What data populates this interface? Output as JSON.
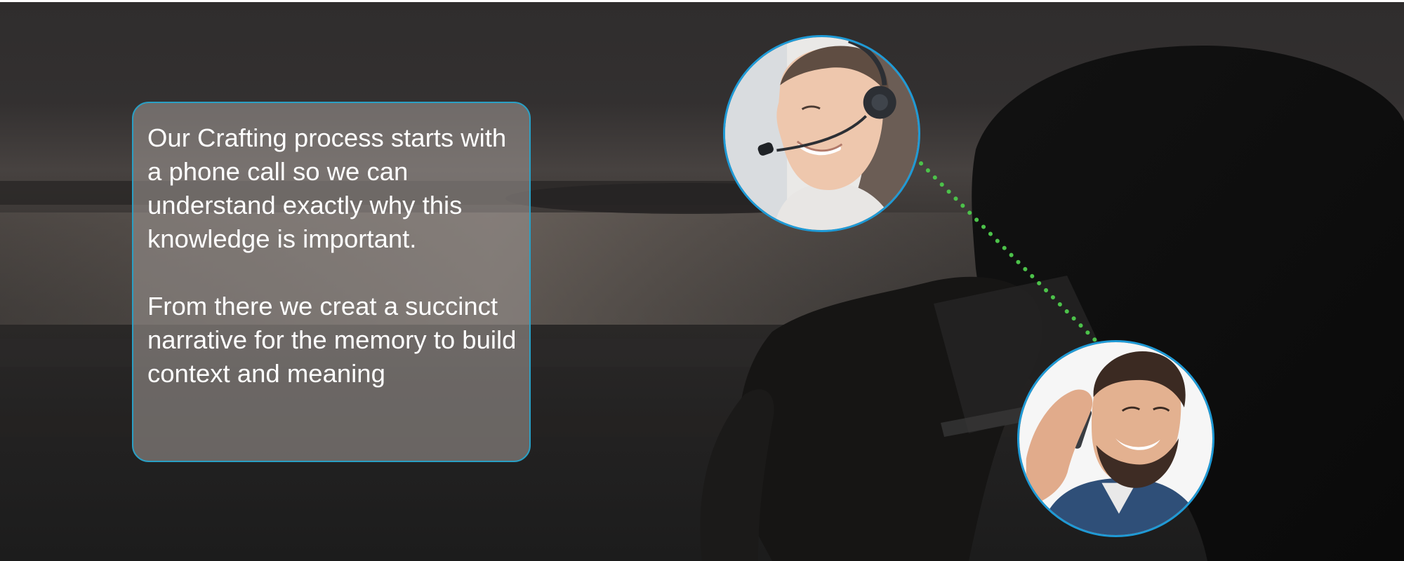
{
  "slide": {
    "paragraphs": [
      "Our Crafting process starts with a phone call so we can understand exactly why this knowledge is important.",
      "From there we creat a succinct narrative for the memory to build context and meaning"
    ]
  },
  "colors": {
    "panel_border": "#2a9fc4",
    "avatar_border": "#1e9ad6",
    "connector_dots": "#4cc24a",
    "text": "#ffffff"
  },
  "icons": {
    "agent": "headset-agent-photo",
    "caller": "phone-caller-photo"
  }
}
